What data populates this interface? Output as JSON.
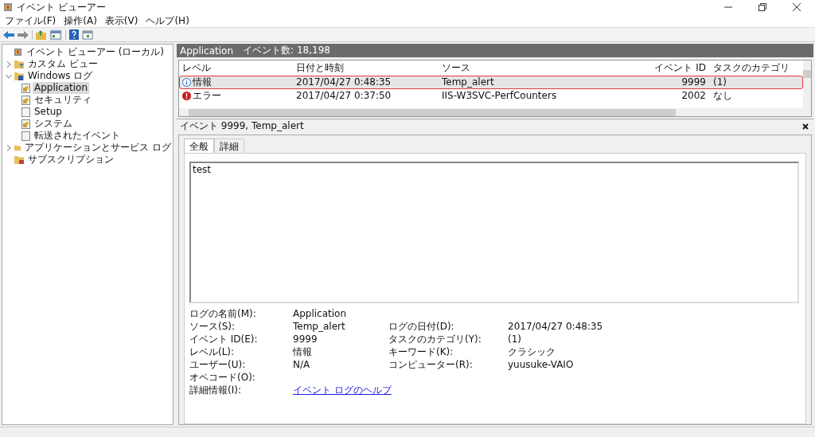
{
  "window": {
    "title": "イベント ビューアー"
  },
  "menu": [
    "ファイル(F)",
    "操作(A)",
    "表示(V)",
    "ヘルプ(H)"
  ],
  "tree": {
    "label": "イベント ビューアー (ローカル)",
    "children": [
      {
        "label": "カスタム ビュー",
        "expanded": false,
        "kind": "filter"
      },
      {
        "label": "Windows ログ",
        "expanded": true,
        "kind": "logs",
        "children": [
          {
            "label": "Application",
            "selected": true,
            "kind": "log"
          },
          {
            "label": "セキュリティ",
            "selected": false,
            "kind": "log"
          },
          {
            "label": "Setup",
            "selected": false,
            "kind": "page"
          },
          {
            "label": "システム",
            "selected": false,
            "kind": "log"
          },
          {
            "label": "転送されたイベント",
            "selected": false,
            "kind": "page"
          }
        ]
      },
      {
        "label": "アプリケーションとサービス ログ",
        "expanded": false,
        "kind": "folder"
      },
      {
        "label": "サブスクリプション",
        "kind": "subscription"
      }
    ]
  },
  "log_header": {
    "name": "Application",
    "count": "イベント数: 18,198"
  },
  "table": {
    "columns": [
      "レベル",
      "日付と時刻",
      "ソース",
      "イベント ID",
      "タスクのカテゴリ"
    ],
    "rows": [
      {
        "level": "情報",
        "kind": "info",
        "date": "2017/04/27 0:48:35",
        "source": "Temp_alert",
        "event_id": "9999",
        "category": "(1)",
        "selected": true
      },
      {
        "level": "エラー",
        "kind": "error",
        "date": "2017/04/27 0:37:50",
        "source": "IIS-W3SVC-PerfCounters",
        "event_id": "2002",
        "category": "なし",
        "selected": false
      }
    ]
  },
  "detail": {
    "title": "イベント 9999, Temp_alert",
    "tabs": [
      {
        "label": "全般",
        "selected": true
      },
      {
        "label": "詳細",
        "selected": false
      }
    ],
    "message": "test",
    "fields": [
      {
        "label": "ログの名前(M):",
        "value": "Application"
      },
      {
        "label": "ソース(S):",
        "value": "Temp_alert",
        "label2": "ログの日付(D):",
        "value2": "2017/04/27 0:48:35"
      },
      {
        "label": "イベント ID(E):",
        "value": "9999",
        "label2": "タスクのカテゴリ(Y):",
        "value2": "(1)"
      },
      {
        "label": "レベル(L):",
        "value": "情報",
        "label2": "キーワード(K):",
        "value2": "クラシック"
      },
      {
        "label": "ユーザー(U):",
        "value": "N/A",
        "label2": "コンピューター(R):",
        "value2": "yuusuke-VAIO"
      },
      {
        "label": "オペコード(O):"
      },
      {
        "label": "詳細情報(I):",
        "value": "イベント ログのヘルプ",
        "kind": "link"
      }
    ]
  }
}
